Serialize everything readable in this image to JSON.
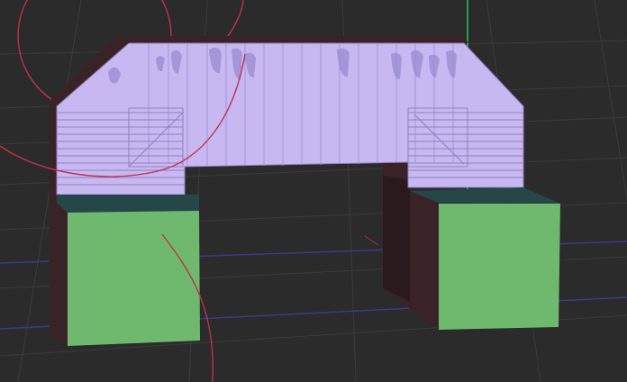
{
  "viewport": {
    "background": "#2b2b2b",
    "grid_color": "#3b3b3b",
    "axis_x_color": "#3a3a8c",
    "axis_y_color": "#22c55e",
    "gizmo_ring_color": "#c0334a"
  },
  "model": {
    "arch_top_color": "#c8b8f2",
    "arch_side_color": "#3a2326",
    "arch_shadow_color": "#2a1a1d",
    "block_front_color": "#6fb96f",
    "block_top_color": "#264747",
    "edge_color": "#8f7fbf",
    "stripe_color": "#a596d8",
    "smudge_color": "#9a8bd0"
  }
}
